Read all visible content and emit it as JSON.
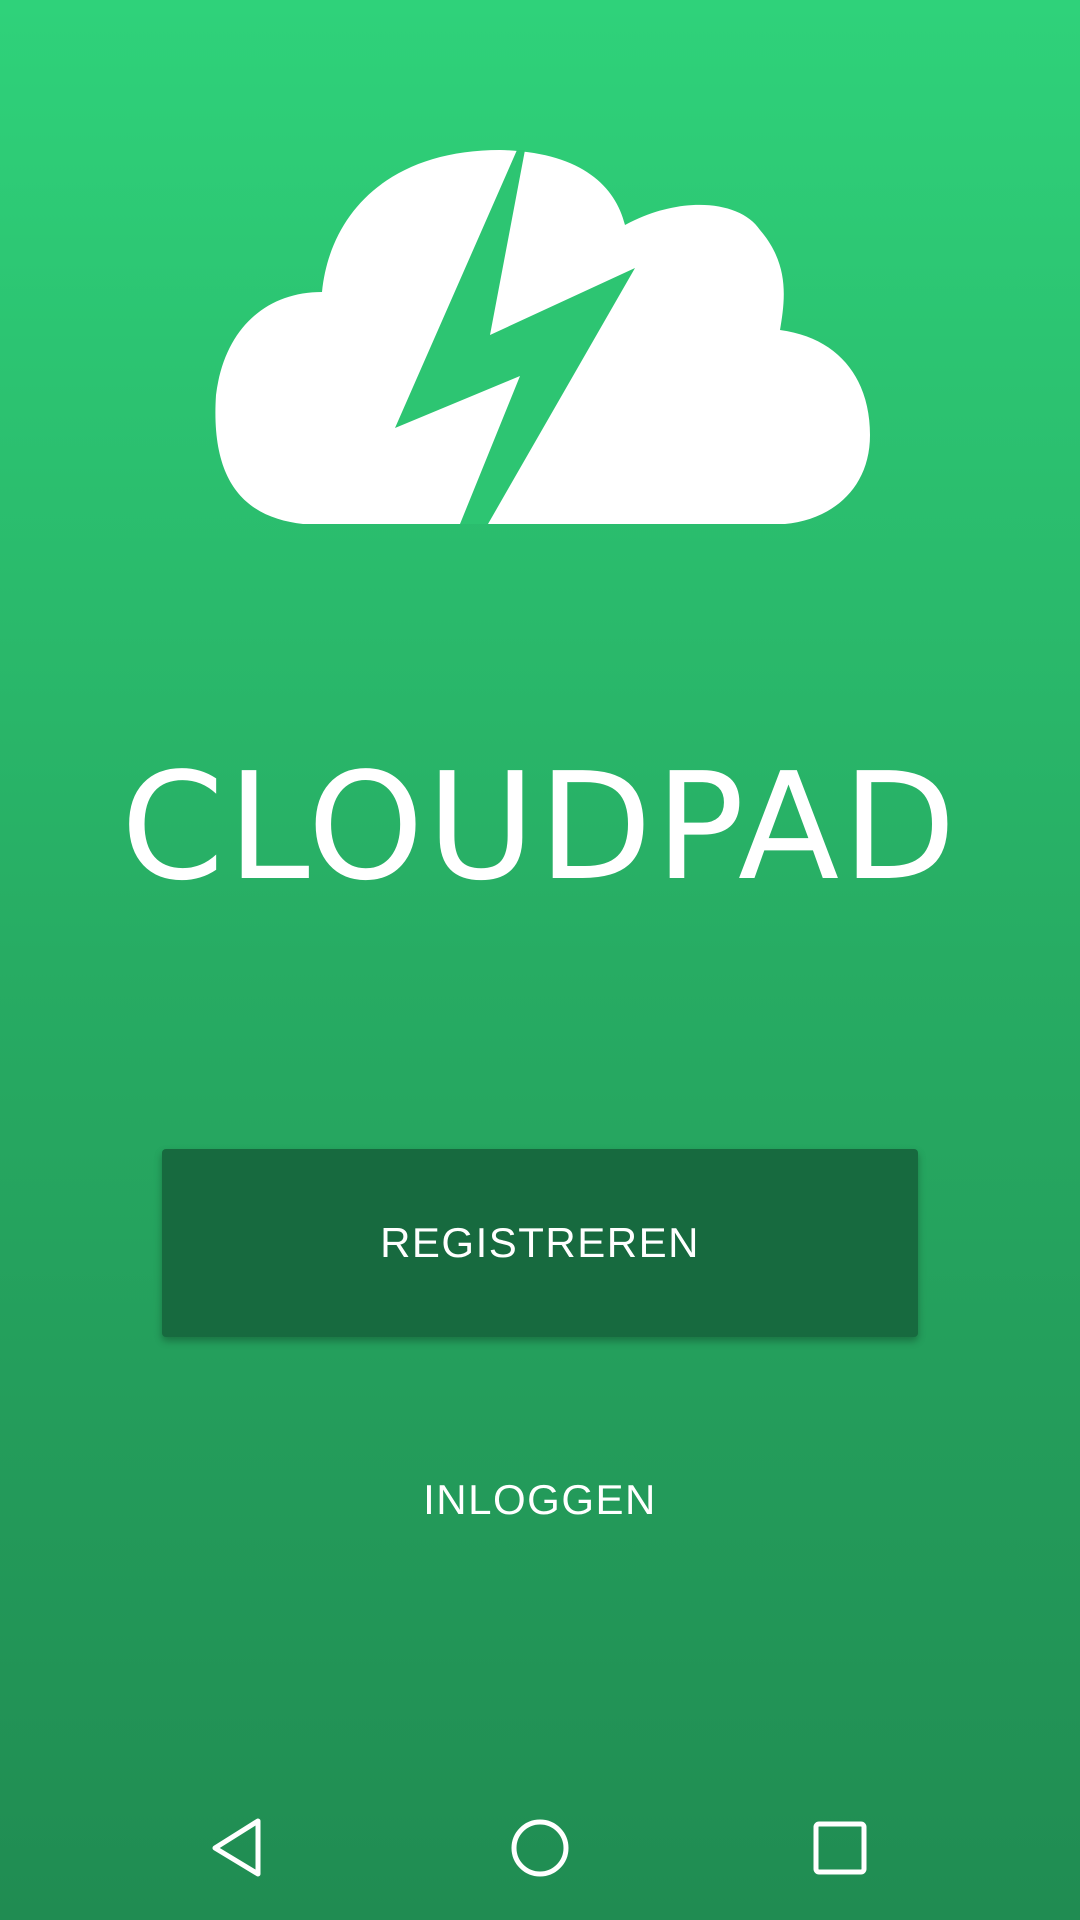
{
  "app": {
    "title": "CLOUDPAD"
  },
  "logo": {
    "icon": "cloud-lightning-icon",
    "color": "#ffffff"
  },
  "actions": {
    "register_label": "REGISTREREN",
    "login_label": "INLOGGEN"
  },
  "navigation_bar": {
    "back_icon": "triangle-back-icon",
    "home_icon": "circle-home-icon",
    "recents_icon": "square-recents-icon"
  },
  "colors": {
    "background_top": "#2fd27a",
    "background_bottom": "#208c52",
    "primary_button": "#176a3f",
    "text": "#ffffff"
  }
}
